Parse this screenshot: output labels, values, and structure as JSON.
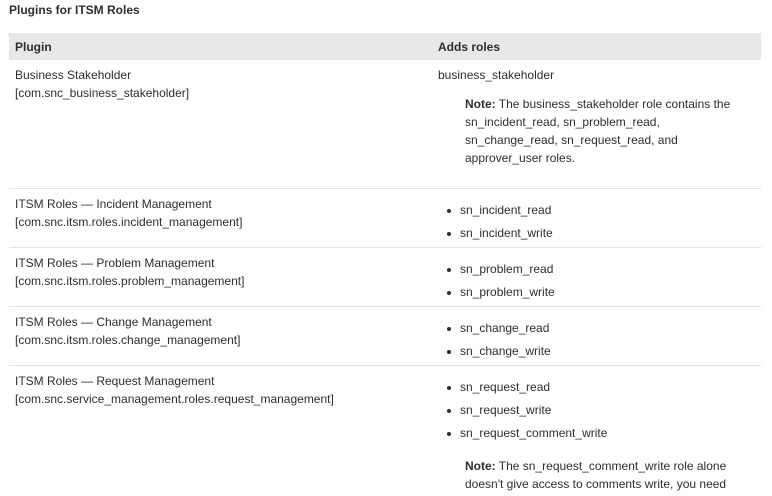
{
  "caption": "Plugins for ITSM Roles",
  "headers": {
    "plugin": "Plugin",
    "adds_roles": "Adds roles"
  },
  "rows": [
    {
      "plugin_line1": "Business Stakeholder",
      "plugin_line2": "[com.snc_business_stakeholder]",
      "role_text": "business_stakeholder",
      "note_label": "Note:",
      "note_text": " The business_stakeholder role contains the sn_incident_read, sn_problem_read, sn_change_read, sn_request_read, and approver_user roles."
    },
    {
      "plugin_line1": "ITSM Roles — Incident Management [com.snc.itsm.roles.incident_management]",
      "roles": [
        "sn_incident_read",
        "sn_incident_write"
      ]
    },
    {
      "plugin_line1": "ITSM Roles — Problem Management [com.snc.itsm.roles.problem_management]",
      "roles": [
        "sn_problem_read",
        "sn_problem_write"
      ]
    },
    {
      "plugin_line1": "ITSM Roles — Change Management [com.snc.itsm.roles.change_management]",
      "roles": [
        "sn_change_read",
        "sn_change_write"
      ]
    },
    {
      "plugin_line1": "ITSM Roles — Request Management",
      "plugin_line2": "[com.snc.service_management.roles.request_management]",
      "roles": [
        "sn_request_read",
        "sn_request_write",
        "sn_request_comment_write"
      ],
      "note_label": "Note:",
      "note_text": " The sn_request_comment_write role alone doesn't give access to comments write, you need write access for the table."
    }
  ]
}
